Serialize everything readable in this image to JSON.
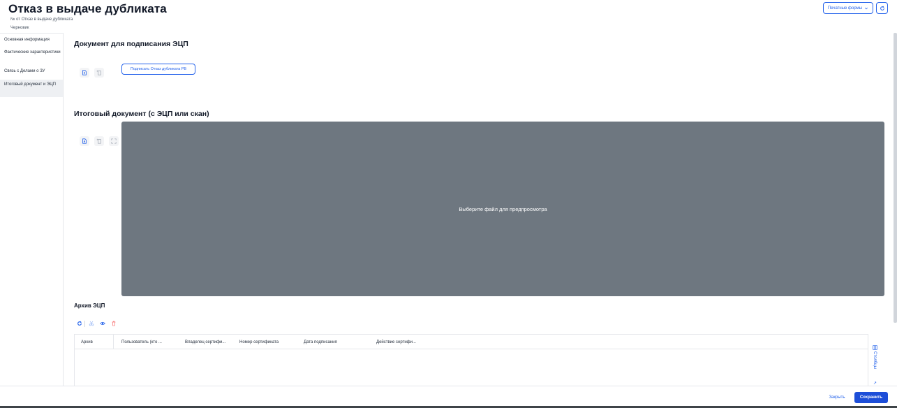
{
  "header": {
    "title": "Отказ в выдаче дубликата",
    "subtitle": "№ от Отказ в выдаче дубликата",
    "status": "Черновик",
    "print_forms_label": "Печатные формы",
    "refresh_icon": "refresh-icon"
  },
  "sidebar": {
    "items": [
      {
        "label": "Основная информация",
        "active": false
      },
      {
        "label": "Фактические характеристики",
        "active": false
      },
      {
        "label": "Связь с Делами о ЗУ",
        "active": false
      },
      {
        "label": "Итоговый документ и ЭЦП",
        "active": true
      }
    ]
  },
  "sign_section": {
    "heading": "Документ для подписания ЭЦП",
    "sign_button_label": "Подписать Отказ дубликата РВ"
  },
  "result_section": {
    "heading": "Итоговый документ (с ЭЦП или скан)",
    "preview_placeholder": "Выберите файл для предпросмотра"
  },
  "archive": {
    "heading": "Архив ЭЦП",
    "columns": [
      "Архив",
      "Пользователь (кто ...",
      "Владелец сертифи...",
      "Номер сертификата",
      "Дата подписания",
      "Действие сертифи..."
    ],
    "rows": [],
    "columns_tab_label": "Столбцы"
  },
  "footer": {
    "close_label": "Закрыть",
    "save_label": "Сохранить"
  },
  "colors": {
    "accent": "#2563eb",
    "save_bg": "#1d4ed8",
    "preview_bg": "#6e7780",
    "delete_icon": "#f87171"
  }
}
